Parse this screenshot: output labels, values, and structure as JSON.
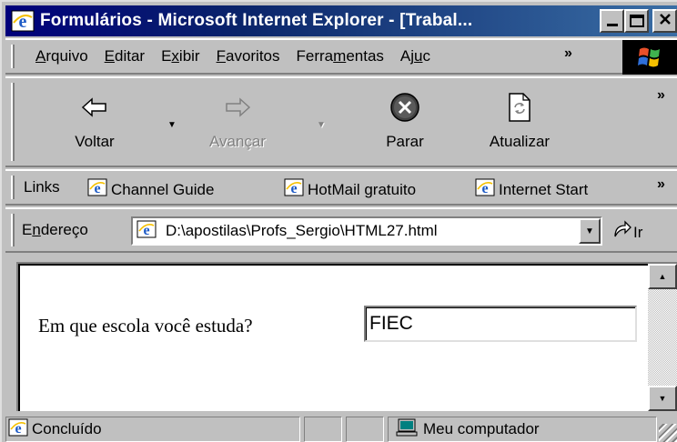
{
  "window": {
    "title": "Formulários - Microsoft Internet Explorer - [Trabal...",
    "minimize_label": "_",
    "maximize_label": "□",
    "close_label": "×"
  },
  "menu": {
    "items": [
      {
        "pre": "",
        "ul": "A",
        "post": "rquivo"
      },
      {
        "pre": "",
        "ul": "E",
        "post": "ditar"
      },
      {
        "pre": "E",
        "ul": "x",
        "post": "ibir"
      },
      {
        "pre": "",
        "ul": "F",
        "post": "avoritos"
      },
      {
        "pre": "Ferra",
        "ul": "m",
        "post": "entas"
      },
      {
        "pre": "Aj",
        "ul": "u",
        "post": "c"
      }
    ],
    "more": "»"
  },
  "toolbar": {
    "back": "Voltar",
    "forward": "Avançar",
    "stop": "Parar",
    "refresh": "Atualizar",
    "more": "»"
  },
  "links": {
    "label": "Links",
    "items": [
      "Channel Guide",
      "HotMail gratuito",
      "Internet Start"
    ],
    "more": "»"
  },
  "address": {
    "label_pre": "E",
    "label_ul": "n",
    "label_post": "dereço",
    "url": "D:\\apostilas\\Profs_Sergio\\HTML27.html",
    "go_label": "Ir"
  },
  "page": {
    "question": "Em que escola você estuda?",
    "answer_value": "FIEC"
  },
  "status": {
    "text": "Concluído",
    "zone": "Meu computador"
  },
  "icons": {
    "title": "ie-icon",
    "back": "back-arrow-icon",
    "forward": "forward-arrow-icon",
    "stop": "stop-icon",
    "refresh": "refresh-icon",
    "go": "go-arrow-icon",
    "zone": "computer-icon"
  },
  "colors": {
    "title_bar_start": "#00007b",
    "title_bar_end": "#3a6ea5",
    "face": "#c0c0c0"
  }
}
